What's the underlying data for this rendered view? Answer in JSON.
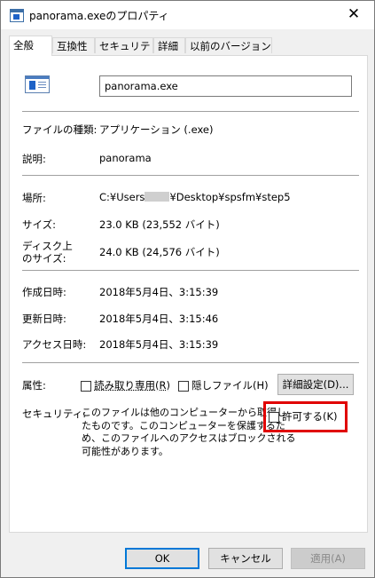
{
  "window": {
    "title": "panorama.exeのプロパティ",
    "close_glyph": "✕"
  },
  "tabs": [
    "全般",
    "互換性",
    "セキュリティ",
    "詳細",
    "以前のバージョン"
  ],
  "general": {
    "file_name": "panorama.exe",
    "file_type_label": "ファイルの種類:",
    "file_type_value": "アプリケーション (.exe)",
    "description_label": "説明:",
    "description_value": "panorama",
    "location_label": "場所:",
    "location_prefix": "C:¥Users",
    "location_suffix": "¥Desktop¥spsfm¥step5",
    "size_label": "サイズ:",
    "size_value": "23.0 KB (23,552 バイト)",
    "disk_size_label_line1": "ディスク上",
    "disk_size_label_line2": "のサイズ:",
    "disk_size_value": "24.0 KB (24,576 バイト)",
    "created_label": "作成日時:",
    "created_value": "2018年5月4日、3:15:39",
    "modified_label": "更新日時:",
    "modified_value": "2018年5月4日、3:15:46",
    "accessed_label": "アクセス日時:",
    "accessed_value": "2018年5月4日、3:15:39",
    "attributes_label": "属性:",
    "readonly_label": "読み取り専用(R)",
    "hidden_label": "隠しファイル(H)",
    "advanced_button": "詳細設定(D)...",
    "security_label": "セキュリティ:",
    "security_text_line1": "このファイルは他のコンピューターから取得し",
    "security_text_line2": "たものです。このコンピューターを保護するた",
    "security_text_line3": "め、このファイルへのアクセスはブロックされる",
    "security_text_line4": "可能性があります。",
    "unblock_label": "許可する(K)"
  },
  "footer": {
    "ok": "OK",
    "cancel": "キャンセル",
    "apply": "適用(A)"
  },
  "colors": {
    "highlight_border": "#e00000",
    "default_button_border": "#0078d7"
  }
}
